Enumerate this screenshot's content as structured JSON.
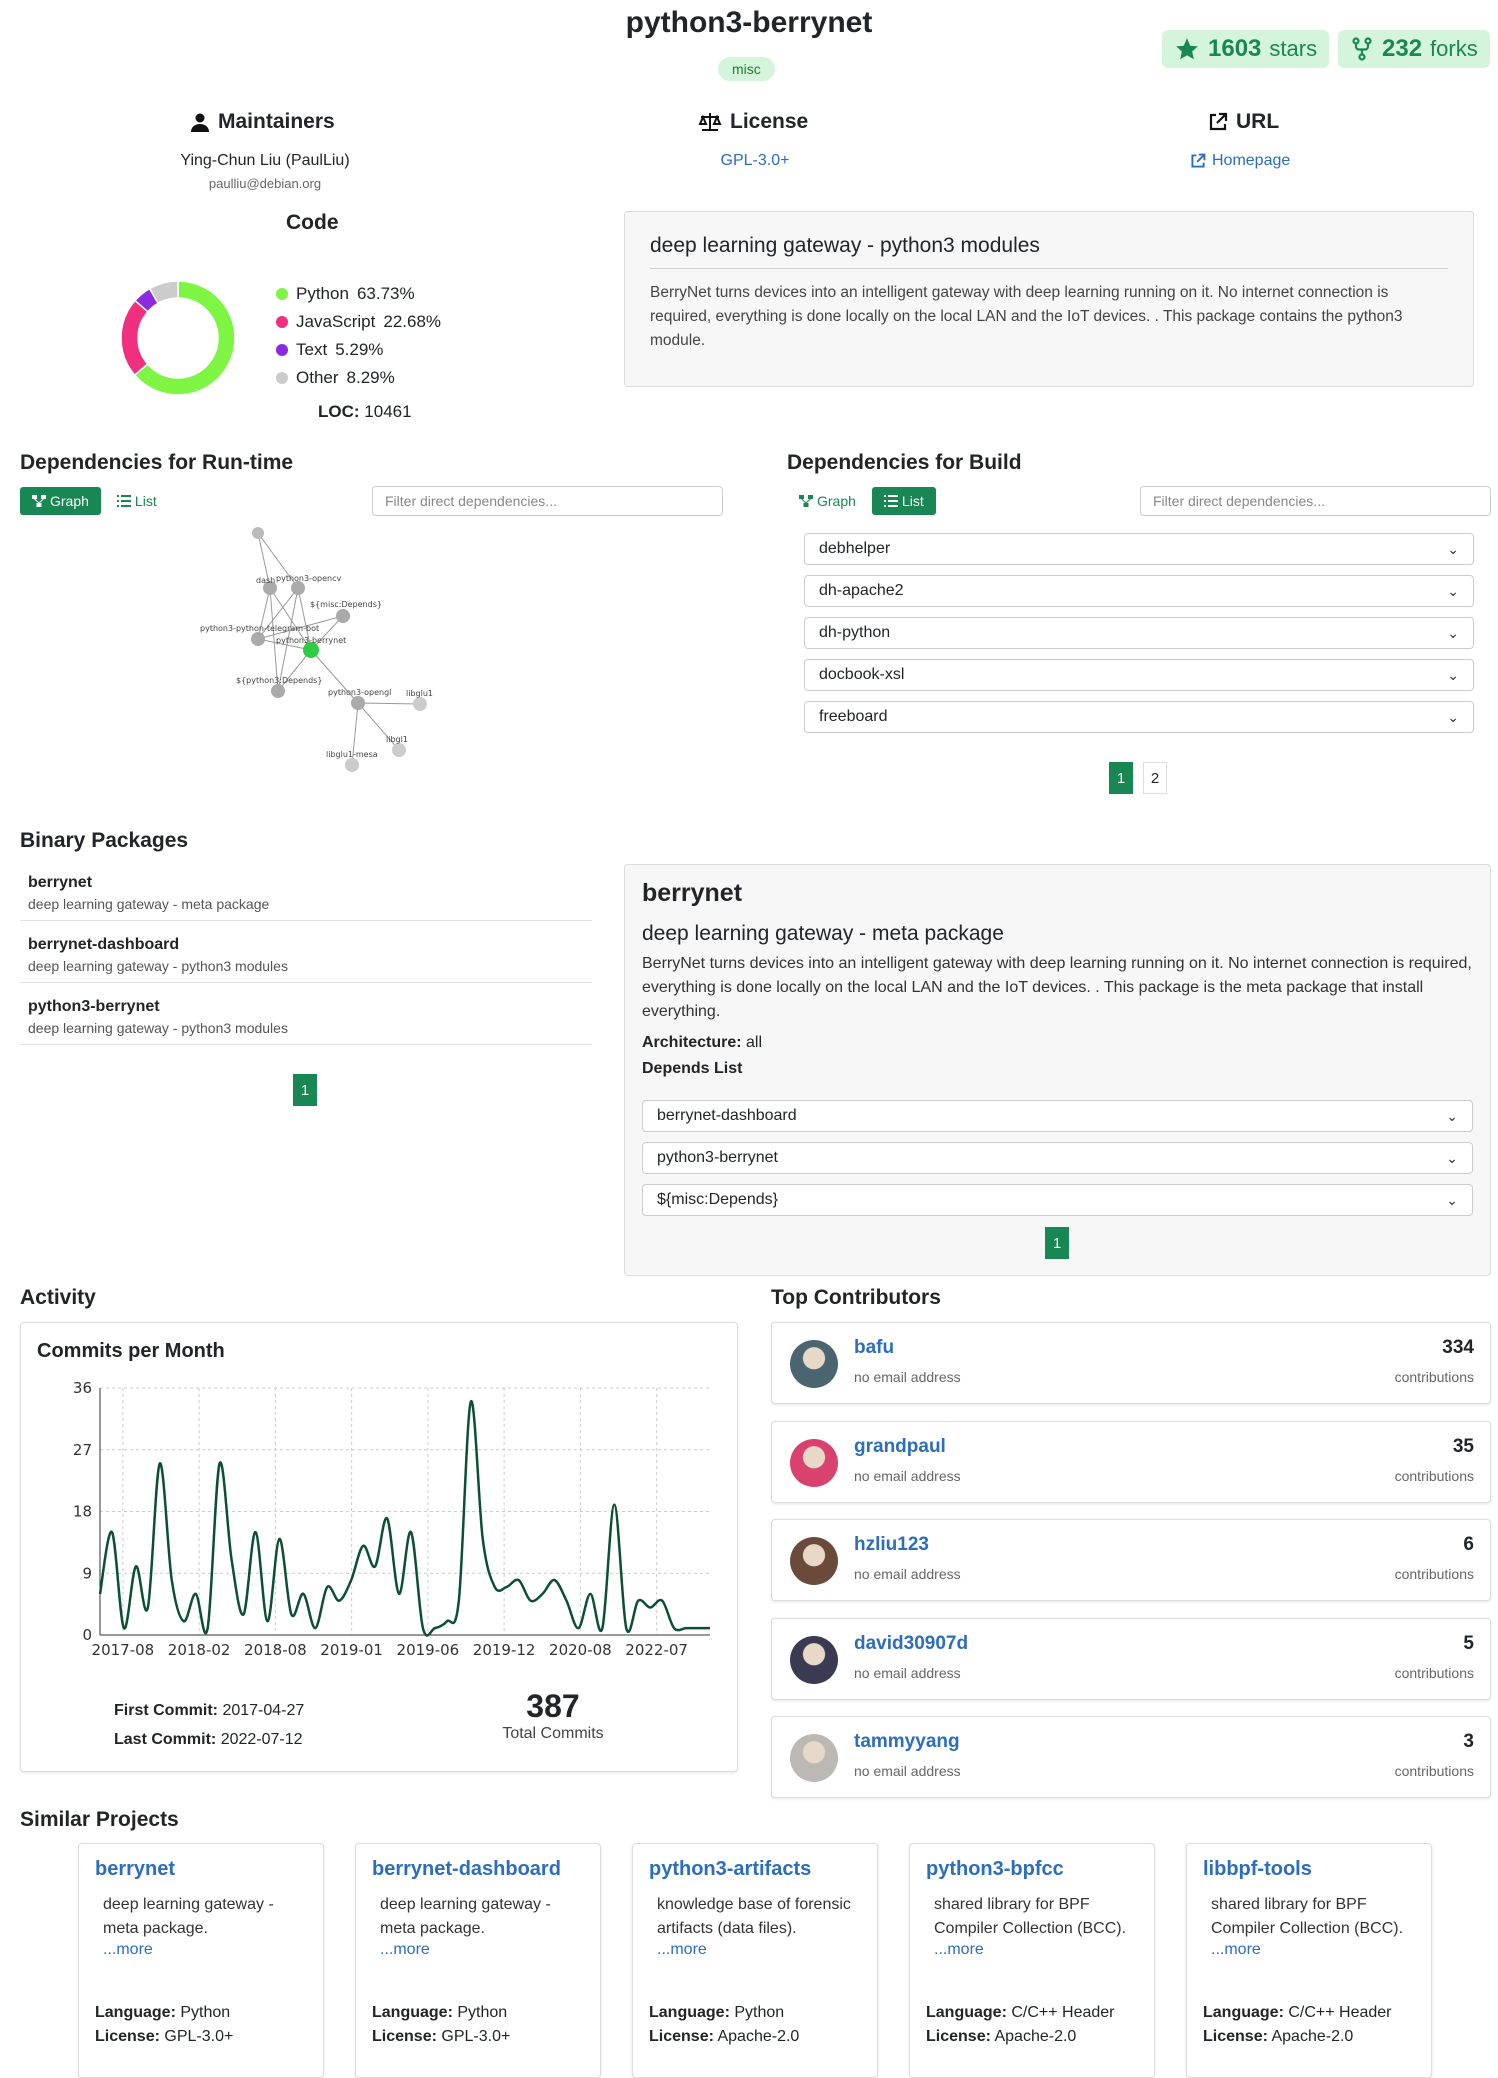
{
  "header": {
    "title": "python3-berrynet",
    "section_badge": "misc",
    "stars_num": "1603",
    "stars_label": "stars",
    "forks_num": "232",
    "forks_label": "forks"
  },
  "maintainers": {
    "heading": "Maintainers",
    "name": "Ying-Chun Liu (PaulLiu)",
    "email": "paulliu@debian.org"
  },
  "license": {
    "heading": "License",
    "value": "GPL-3.0+"
  },
  "url": {
    "heading": "URL",
    "link": "Homepage"
  },
  "code": {
    "heading": "Code",
    "languages": [
      {
        "name": "Python",
        "pct": "63.73%",
        "value": 63.73,
        "color": "#7ef542"
      },
      {
        "name": "JavaScript",
        "pct": "22.68%",
        "value": 22.68,
        "color": "#f0307e"
      },
      {
        "name": "Text",
        "pct": "5.29%",
        "value": 5.29,
        "color": "#8a2be2"
      },
      {
        "name": "Other",
        "pct": "8.29%",
        "value": 8.29,
        "color": "#cccccc"
      }
    ],
    "loc_label": "LOC:",
    "loc_value": "10461"
  },
  "description": {
    "title": "deep learning gateway - python3 modules",
    "text": "BerryNet turns devices into an intelligent gateway with deep learning running on it. No internet connection is required, everything is done locally on the local LAN and the IoT devices. . This package contains the python3 module."
  },
  "deps_runtime": {
    "heading": "Dependencies for Run-time",
    "graph_label": "Graph",
    "list_label": "List",
    "filter_placeholder": "Filter direct dependencies...",
    "graph_nodes": [
      "python3-opencv",
      "dash",
      "${misc:Depends}",
      "python3-python-telegram-bot",
      "python3-berrynet",
      "${python3:Depends}",
      "python3-opengl",
      "libglu1",
      "libgl1",
      "libglu1-mesa"
    ]
  },
  "deps_build": {
    "heading": "Dependencies for Build",
    "graph_label": "Graph",
    "list_label": "List",
    "filter_placeholder": "Filter direct dependencies...",
    "items": [
      "debhelper",
      "dh-apache2",
      "dh-python",
      "docbook-xsl",
      "freeboard"
    ],
    "pages": [
      "1",
      "2"
    ]
  },
  "binary_packages": {
    "heading": "Binary Packages",
    "items": [
      {
        "name": "berrynet",
        "desc": "deep learning gateway - meta package"
      },
      {
        "name": "berrynet-dashboard",
        "desc": "deep learning gateway - python3 modules"
      },
      {
        "name": "python3-berrynet",
        "desc": "deep learning gateway - python3 modules"
      }
    ],
    "page": "1"
  },
  "binary_detail": {
    "name": "berrynet",
    "subtitle": "deep learning gateway - meta package",
    "text": "BerryNet turns devices into an intelligent gateway with deep learning running on it. No internet connection is required, everything is done locally on the local LAN and the IoT devices. . This package is the meta package that install everything.",
    "arch_label": "Architecture:",
    "arch_value": "all",
    "depends_label": "Depends List",
    "depends": [
      "berrynet-dashboard",
      "python3-berrynet",
      "${misc:Depends}"
    ],
    "page": "1"
  },
  "activity": {
    "heading": "Activity",
    "chart_title": "Commits per Month",
    "first_label": "First Commit:",
    "first_value": "2017-04-27",
    "last_label": "Last Commit:",
    "last_value": "2022-07-12",
    "total_value": "387",
    "total_label": "Total Commits"
  },
  "chart_data": {
    "type": "line",
    "title": "Commits per Month",
    "xlabel": "",
    "ylabel": "",
    "ylim": [
      0,
      36
    ],
    "yticks": [
      0,
      9,
      18,
      27,
      36
    ],
    "xticks": [
      "2017-08",
      "2018-02",
      "2018-08",
      "2019-01",
      "2019-06",
      "2019-12",
      "2020-08",
      "2022-07"
    ],
    "grid": true,
    "color": "#0d4f35",
    "values": [
      6,
      15,
      1,
      10,
      4,
      25,
      8,
      2,
      6,
      1,
      25,
      11,
      3,
      15,
      2,
      14,
      3,
      6,
      1,
      7,
      5,
      8,
      13,
      10,
      17,
      6,
      15,
      1,
      1,
      2,
      5,
      34,
      14,
      7,
      7,
      8,
      5,
      6,
      8,
      5,
      1,
      6,
      1,
      19,
      1,
      5,
      4,
      5,
      1,
      1,
      1,
      1
    ]
  },
  "contributors": {
    "heading": "Top Contributors",
    "items": [
      {
        "name": "bafu",
        "email": "no email address",
        "count": "334",
        "label": "contributions",
        "color": "#4a6470"
      },
      {
        "name": "grandpaul",
        "email": "no email address",
        "count": "35",
        "label": "contributions",
        "color": "#d9426e"
      },
      {
        "name": "hzliu123",
        "email": "no email address",
        "count": "6",
        "label": "contributions",
        "color": "#6a4a3a"
      },
      {
        "name": "david30907d",
        "email": "no email address",
        "count": "5",
        "label": "contributions",
        "color": "#3a3a50"
      },
      {
        "name": "tammyyang",
        "email": "no email address",
        "count": "3",
        "label": "contributions",
        "color": "#bcb8b4"
      }
    ]
  },
  "similar": {
    "heading": "Similar Projects",
    "lang_label": "Language:",
    "lic_label": "License:",
    "more": "...more",
    "items": [
      {
        "name": "berrynet",
        "desc": "deep learning gateway - meta package.",
        "lang": "Python",
        "license": "GPL-3.0+"
      },
      {
        "name": "berrynet-dashboard",
        "desc": "deep learning gateway - meta package.",
        "lang": "Python",
        "license": "GPL-3.0+"
      },
      {
        "name": "python3-artifacts",
        "desc": "knowledge base of forensic artifacts (data files).",
        "lang": "Python",
        "license": "Apache-2.0"
      },
      {
        "name": "python3-bpfcc",
        "desc": "shared library for BPF Compiler Collection (BCC).",
        "lang": "C/C++ Header",
        "license": "Apache-2.0"
      },
      {
        "name": "libbpf-tools",
        "desc": "shared library for BPF Compiler Collection (BCC).",
        "lang": "C/C++ Header",
        "license": "Apache-2.0"
      }
    ]
  }
}
